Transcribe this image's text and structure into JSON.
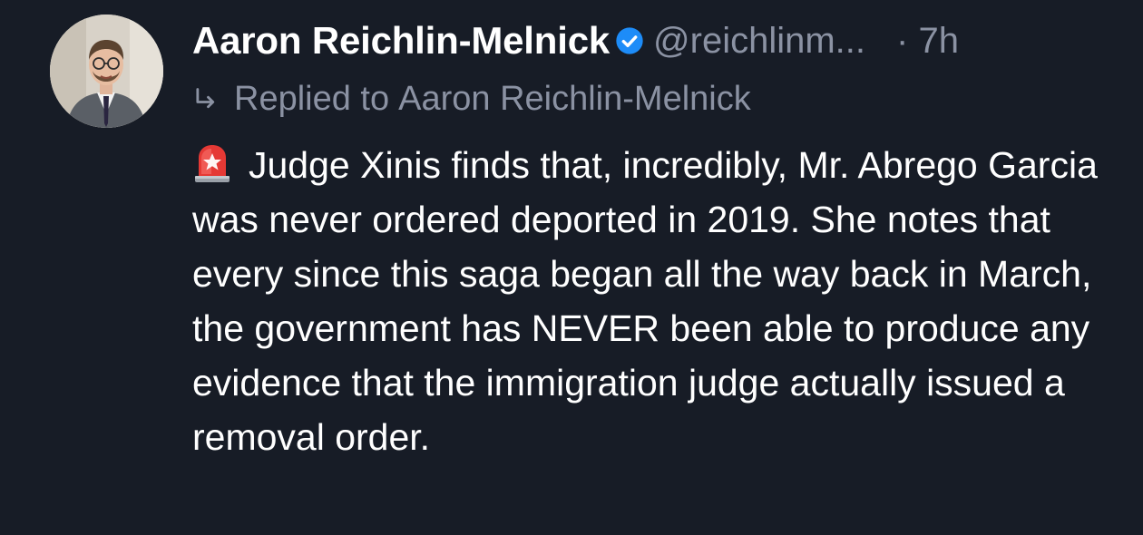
{
  "post": {
    "author": {
      "display_name": "Aaron Reichlin-Melnick",
      "handle": "@reichlinm...",
      "verified_icon": "verified-badge-icon",
      "avatar": "avatar-photo"
    },
    "timestamp": "· 7h",
    "reply": {
      "prefix": "Replied to",
      "target": "Aaron Reichlin-Melnick",
      "icon": "reply-arrow-icon"
    },
    "body": {
      "emoji": "rotating-light-icon",
      "text": "Judge Xinis finds that, incredibly, Mr. Abrego Garcia was never ordered deported in 2019. She notes that every since this saga began all the way back in March, the government has NEVER been able to produce any evidence that the immigration judge actually issued a removal order."
    }
  },
  "colors": {
    "background": "#171c26",
    "text": "#ffffff",
    "muted": "#8b92a3",
    "verified": "#1d8cf8",
    "siren": "#e53935"
  }
}
